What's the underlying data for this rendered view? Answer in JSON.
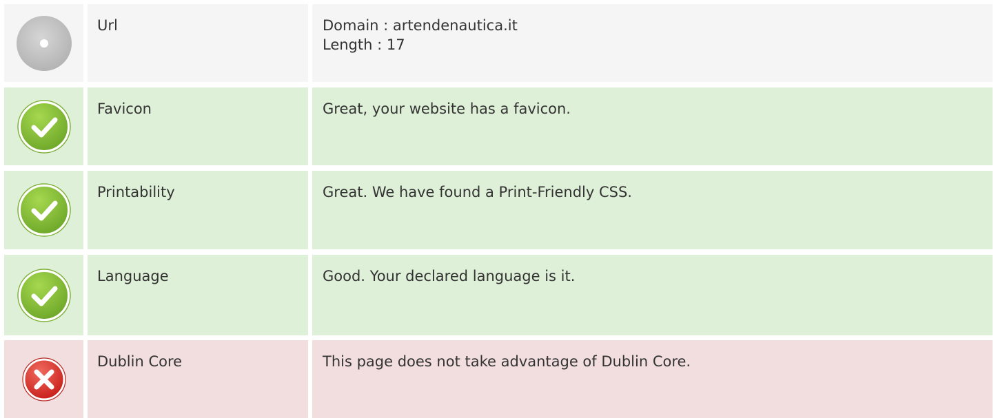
{
  "rows": [
    {
      "status": "info",
      "icon": "info-disc-icon",
      "name": "Url",
      "lines": [
        "Domain : artendenautica.it",
        "Length : 17"
      ]
    },
    {
      "status": "pass",
      "icon": "checkmark-icon",
      "name": "Favicon",
      "lines": [
        "Great, your website has a favicon."
      ]
    },
    {
      "status": "pass",
      "icon": "checkmark-icon",
      "name": "Printability",
      "lines": [
        "Great. We have found a Print-Friendly CSS."
      ]
    },
    {
      "status": "pass",
      "icon": "checkmark-icon",
      "name": "Language",
      "lines": [
        "Good. Your declared language is it."
      ]
    },
    {
      "status": "fail",
      "icon": "cross-icon",
      "name": "Dublin Core",
      "lines": [
        "This page does not take advantage of Dublin Core."
      ]
    }
  ],
  "colors": {
    "neutral_bg": "#f5f5f5",
    "pass_bg": "#dff0d8",
    "fail_bg": "#f2dede",
    "pass_icon": "#8cc63e",
    "fail_icon": "#e23b3b",
    "info_icon": "#bdbdbd",
    "text": "#333333"
  }
}
